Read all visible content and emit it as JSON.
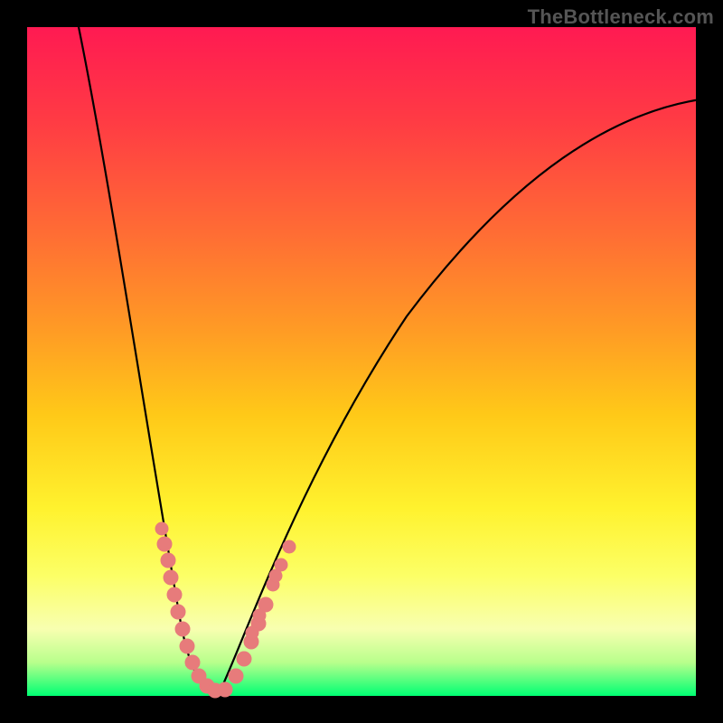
{
  "watermark": "TheBottleneck.com",
  "chart_data": {
    "type": "line",
    "title": "",
    "xlabel": "",
    "ylabel": "",
    "xlim": [
      0,
      100
    ],
    "ylim": [
      0,
      100
    ],
    "grid": false,
    "legend": false,
    "background_gradient": {
      "stops": [
        {
          "pos": 0.0,
          "color": "#ff1a52"
        },
        {
          "pos": 0.3,
          "color": "#ff6a35"
        },
        {
          "pos": 0.58,
          "color": "#ffc918"
        },
        {
          "pos": 0.82,
          "color": "#fcff66"
        },
        {
          "pos": 1.0,
          "color": "#00ff73"
        }
      ]
    },
    "series": [
      {
        "name": "left-curve",
        "color": "#000000",
        "x": [
          7,
          10,
          13,
          16,
          19,
          22,
          24,
          26,
          28
        ],
        "values": [
          100,
          75,
          55,
          38,
          22,
          10,
          4,
          1,
          0
        ]
      },
      {
        "name": "right-curve",
        "color": "#000000",
        "x": [
          28,
          32,
          38,
          46,
          56,
          68,
          82,
          100
        ],
        "values": [
          0,
          10,
          27,
          45,
          62,
          76,
          85,
          90
        ]
      },
      {
        "name": "left-markers",
        "color": "#e77b7b",
        "style": "scatter",
        "x": [
          20,
          20.5,
          21,
          21.5,
          22,
          22.5,
          23,
          24,
          25,
          26,
          27,
          28,
          29.5
        ],
        "values": [
          25,
          23,
          20,
          18,
          15,
          13,
          10,
          8,
          5,
          3,
          2,
          1,
          1
        ]
      },
      {
        "name": "right-markers",
        "color": "#e77b7b",
        "style": "scatter",
        "x": [
          31,
          32,
          33,
          34,
          35,
          36,
          37,
          38,
          39
        ],
        "values": [
          3,
          5,
          8,
          11,
          14,
          17,
          20,
          22,
          24
        ]
      }
    ],
    "annotations": [
      {
        "text": "TheBottleneck.com",
        "position": "top-right"
      }
    ]
  }
}
